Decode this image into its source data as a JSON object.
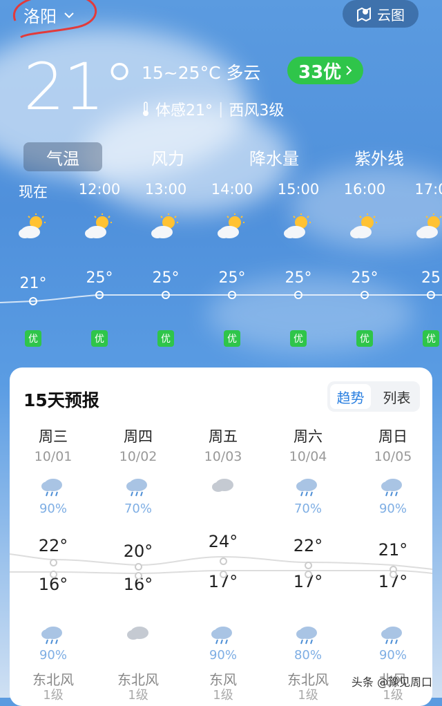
{
  "header": {
    "city": "洛阳",
    "cloud_map_label": "云图"
  },
  "current": {
    "temperature": "21°",
    "range_condition": "15~25°C 多云",
    "aqi": "33优",
    "feels_like": "体感21°",
    "wind": "西风3级"
  },
  "tabs": [
    "气温",
    "风力",
    "降水量",
    "紫外线"
  ],
  "hourly": [
    {
      "time": "现在",
      "temp": "21°",
      "aqi": "优"
    },
    {
      "time": "12:00",
      "temp": "25°",
      "aqi": "优"
    },
    {
      "time": "13:00",
      "temp": "25°",
      "aqi": "优"
    },
    {
      "time": "14:00",
      "temp": "25°",
      "aqi": "优"
    },
    {
      "time": "15:00",
      "temp": "25°",
      "aqi": "优"
    },
    {
      "time": "16:00",
      "temp": "25°",
      "aqi": "优"
    },
    {
      "time": "17:0",
      "temp": "25",
      "aqi": "优"
    }
  ],
  "forecast": {
    "title": "15天预报",
    "toggle": [
      "趋势",
      "列表"
    ],
    "days": [
      {
        "weekday": "周三",
        "date": "10/01",
        "day_pct": "90%",
        "high": "22°",
        "low": "16°",
        "night_pct": "90%",
        "wind": "东北风",
        "level": "1级"
      },
      {
        "weekday": "周四",
        "date": "10/02",
        "day_pct": "70%",
        "high": "20°",
        "low": "16°",
        "night_pct": "",
        "wind": "东北风",
        "level": "1级"
      },
      {
        "weekday": "周五",
        "date": "10/03",
        "day_pct": "",
        "high": "24°",
        "low": "17°",
        "night_pct": "90%",
        "wind": "东风",
        "level": "1级"
      },
      {
        "weekday": "周六",
        "date": "10/04",
        "day_pct": "70%",
        "high": "22°",
        "low": "17°",
        "night_pct": "80%",
        "wind": "东北风",
        "level": "1级"
      },
      {
        "weekday": "周日",
        "date": "10/05",
        "day_pct": "90%",
        "high": "21°",
        "low": "17°",
        "night_pct": "90%",
        "wind": "北风",
        "level": "1级"
      }
    ]
  },
  "watermark": "头条 @豫见周口",
  "colors": {
    "aqi_green": "#2fc54a",
    "accent_blue": "#2a7fe0",
    "sky": "#4f90db"
  }
}
